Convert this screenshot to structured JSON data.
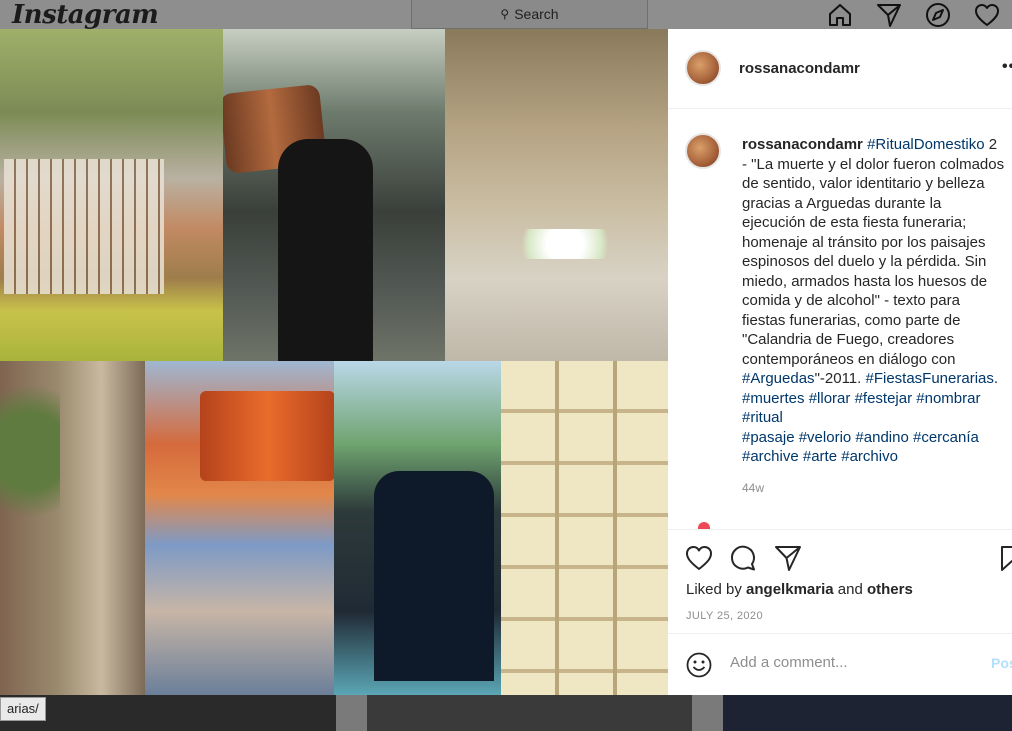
{
  "nav": {
    "logo": "Instagram",
    "search_placeholder": "Search",
    "icons": [
      "home-icon",
      "direct-icon",
      "explore-icon",
      "activity-heart-icon"
    ]
  },
  "feed": {
    "link_tooltip": "arias/"
  },
  "post": {
    "images": [
      "village-cemetery-niches-photo",
      "men-carrying-coffin-photo",
      "empty-tomb-with-flowers-photo",
      "dirt-alley-with-tree-photo",
      "man-carrying-coffin-colored-photo",
      "procession-in-suits-photo",
      "cemetery-niche-wall-photo"
    ],
    "author": {
      "username": "rossanacondamr"
    },
    "caption": {
      "username": "rossanacondamr",
      "tag_ritual": "#RitualDomestiko",
      "text_1": " 2 - \"La muerte y el dolor fueron colmados de sentido, valor identitario y belleza gracias a Arguedas durante la ejecución de esta fiesta funeraria; homenaje al tránsito por los paisajes espinosos del duelo y la pérdida. Sin miedo, armados hasta los huesos de comida y de alcohol\" - texto para fiestas funerarias, como parte de \"Calandria de Fuego, creadores contemporáneos en diálogo con ",
      "tag_arguedas": "#Arguedas",
      "text_2": "\"-2011. ",
      "tag_fiestas": "#FiestasFunerarias",
      "text_3": ".",
      "line_tags_1": [
        "#muertes",
        "#llorar",
        "#festejar",
        "#nombrar"
      ],
      "line_tags_2": [
        "#ritual"
      ],
      "line_tags_3": [
        "#pasaje",
        "#velorio",
        "#andino",
        "#cercanía"
      ],
      "line_tags_4": [
        "#archive",
        "#arte",
        "#archivo"
      ]
    },
    "time_ago": "44w",
    "likes": {
      "prefix": "Liked by ",
      "user": "angelkmaria",
      "middle": " and ",
      "others": "others"
    },
    "date": "JULY 25, 2020",
    "comment": {
      "placeholder": "Add a comment...",
      "post_label": "Post"
    }
  }
}
